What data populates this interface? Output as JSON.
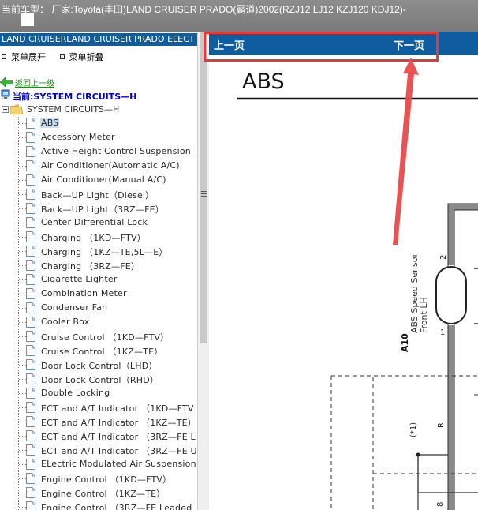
{
  "window": {
    "title": "当前车型： 厂家:Toyota(丰田)LAND CRUISER PRADO(霸道)2002(RZJ12 LJ12 KZJ120 KDJ12)-"
  },
  "left_panel": {
    "header": "LAND CRUISERLAND CRUISER PRADO ELECT",
    "expand_label": "菜单展开",
    "collapse_label": "菜单折叠",
    "back_link": "返回上一级",
    "current_label": "当前:SYSTEM CIRCUITS—H",
    "root_folder": "SYSTEM CIRCUITS—H",
    "items": [
      "ABS",
      "Accessory Meter",
      "Active Height Control Suspension",
      "Air Conditioner(Automatic A/C)",
      "Air Conditioner(Manual A/C)",
      "Back—UP Light（Diesel）",
      "Back—UP Light（3RZ—FE）",
      "Center Differential Lock",
      "Charging （1KD—FTV）",
      "Charging （1KZ—TE,5L—E）",
      "Charging （3RZ—FE）",
      "Cigarette Lighter",
      "Combination Meter",
      "Condenser Fan",
      "Cooler Box",
      "Cruise Control （1KD—FTV）",
      "Cruise Control （1KZ—TE）",
      "Door Lock Control（LHD）",
      "Door Lock Control（RHD）",
      "Double Locking",
      "ECT and A/T Indicator （1KD—FTV",
      "ECT and A/T Indicator （1KZ—TE）",
      "ECT and A/T Indicator （3RZ—FE L",
      "ECT and A/T Indicator （3RZ—FE U",
      "ELectric Modulated Air Suspension",
      "Engine Control （1KD—FTV）",
      "Engine Control （1KZ—TE）",
      "Engine Control （3RZ—FE Leaded"
    ]
  },
  "viewer": {
    "prev_label": "上一页",
    "next_label": "下一页",
    "page_title": "ABS",
    "sensor_code": "A10",
    "sensor_name": "ABS Speed Sensor",
    "sensor_pos": "Front LH",
    "pin_top": "2",
    "pin_bottom": "1",
    "wire_label_r": "R",
    "wire_label_1": "(*1)",
    "pin_8": "8"
  },
  "colors": {
    "header_blue": "#0f5d9e",
    "highlight_red": "#e23a3a",
    "link_green": "#1e8a1e",
    "current_blue": "#0000cc"
  }
}
